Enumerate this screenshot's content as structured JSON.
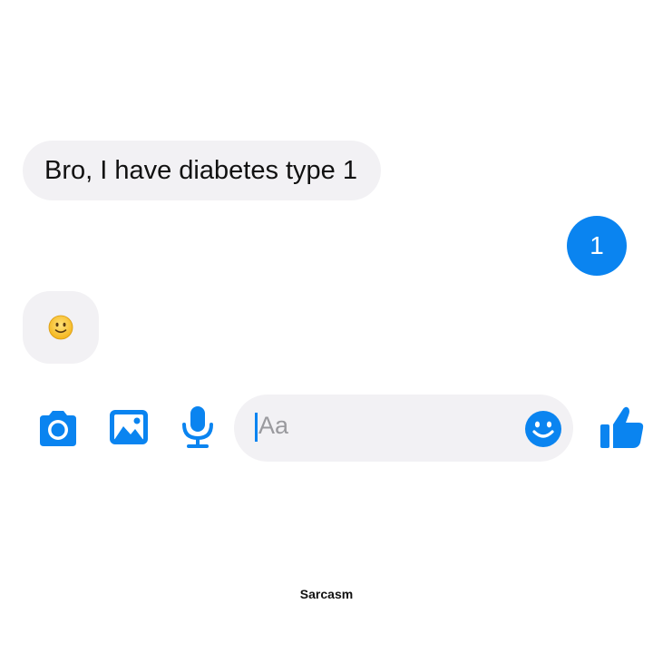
{
  "conversation": {
    "received_message": "Bro, I have diabetes type 1",
    "sent_message": "1",
    "emoji_reply": {
      "icon": "slightly-smiling-face-emoji"
    }
  },
  "composer": {
    "placeholder": "Aa",
    "icons": [
      "camera-icon",
      "image-icon",
      "microphone-icon",
      "emoji-icon",
      "thumbs-up-icon"
    ]
  },
  "caption": "Sarcasm",
  "colors": {
    "accent": "#0a84f0",
    "bubble_gray": "#f2f1f4",
    "text": "#111111"
  }
}
